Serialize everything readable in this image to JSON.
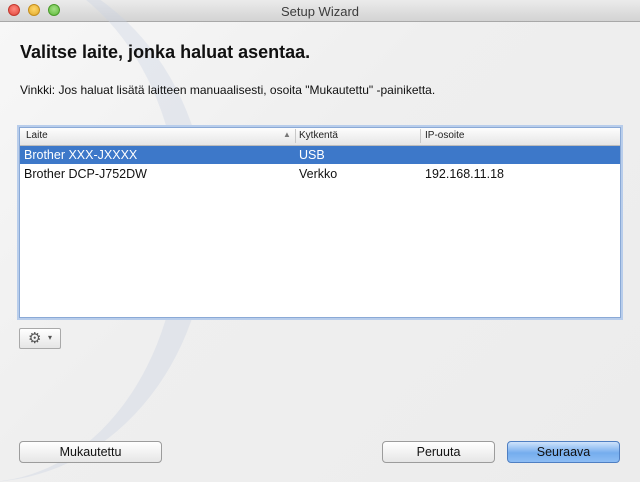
{
  "window": {
    "title": "Setup Wizard"
  },
  "main": {
    "heading": "Valitse laite, jonka haluat asentaa.",
    "tip": "Vinkki: Jos haluat lisätä laitteen manuaalisesti, osoita \"Mukautettu\" -painiketta."
  },
  "table": {
    "columns": [
      "Laite",
      "Kytkentä",
      "IP-osoite"
    ],
    "rows": [
      {
        "device": "Brother XXX-JXXXX",
        "connection": "USB",
        "ip": "",
        "selected": true
      },
      {
        "device": "Brother DCP-J752DW",
        "connection": "Verkko",
        "ip": "192.168.11.18",
        "selected": false
      }
    ]
  },
  "toolbar": {
    "gear_icon": "gear-icon",
    "caret": "▾"
  },
  "buttons": {
    "custom": "Mukautettu",
    "cancel": "Peruuta",
    "next": "Seuraava"
  },
  "colors": {
    "selection": "#3d78c9",
    "primary_button": "#75adee"
  }
}
